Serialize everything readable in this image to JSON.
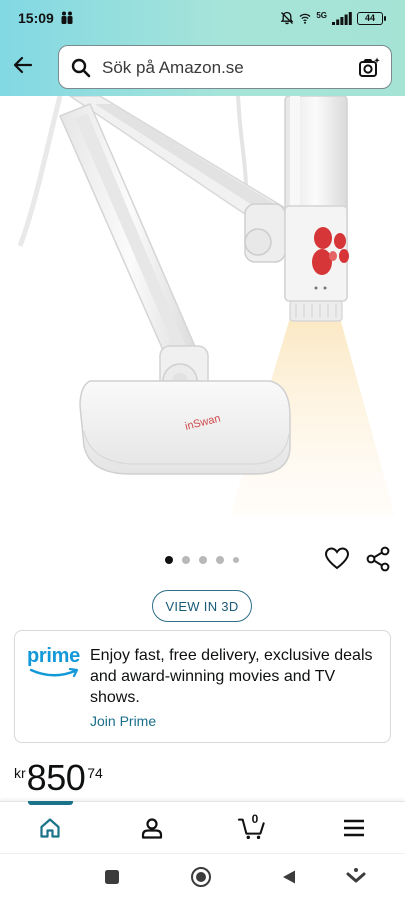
{
  "status_bar": {
    "time": "15:09",
    "network": "5G",
    "battery": "44"
  },
  "search": {
    "placeholder": "Sök på Amazon.se"
  },
  "product": {
    "brand_mark": "inSwan"
  },
  "carousel": {
    "total_dots": 5,
    "active_index": 0
  },
  "view_3d": {
    "label": "VIEW IN 3D"
  },
  "prime": {
    "logo_text": "prime",
    "description": "Enjoy fast, free delivery, exclusive deals and award-winning movies and TV shows.",
    "link": "Join Prime"
  },
  "price": {
    "currency": "kr",
    "whole": "850",
    "fraction": "74"
  },
  "bottom_nav": {
    "items": [
      "home-icon",
      "account-icon",
      "cart-icon",
      "menu-icon"
    ],
    "active": "home-icon",
    "cart_count": "0"
  },
  "colors": {
    "header_gradient_start": "#82d8e3",
    "header_gradient_end": "#a5e3d5",
    "prime_blue": "#1399d8",
    "link_teal": "#1b6e8a",
    "nav_indicator": "#1b7389"
  }
}
